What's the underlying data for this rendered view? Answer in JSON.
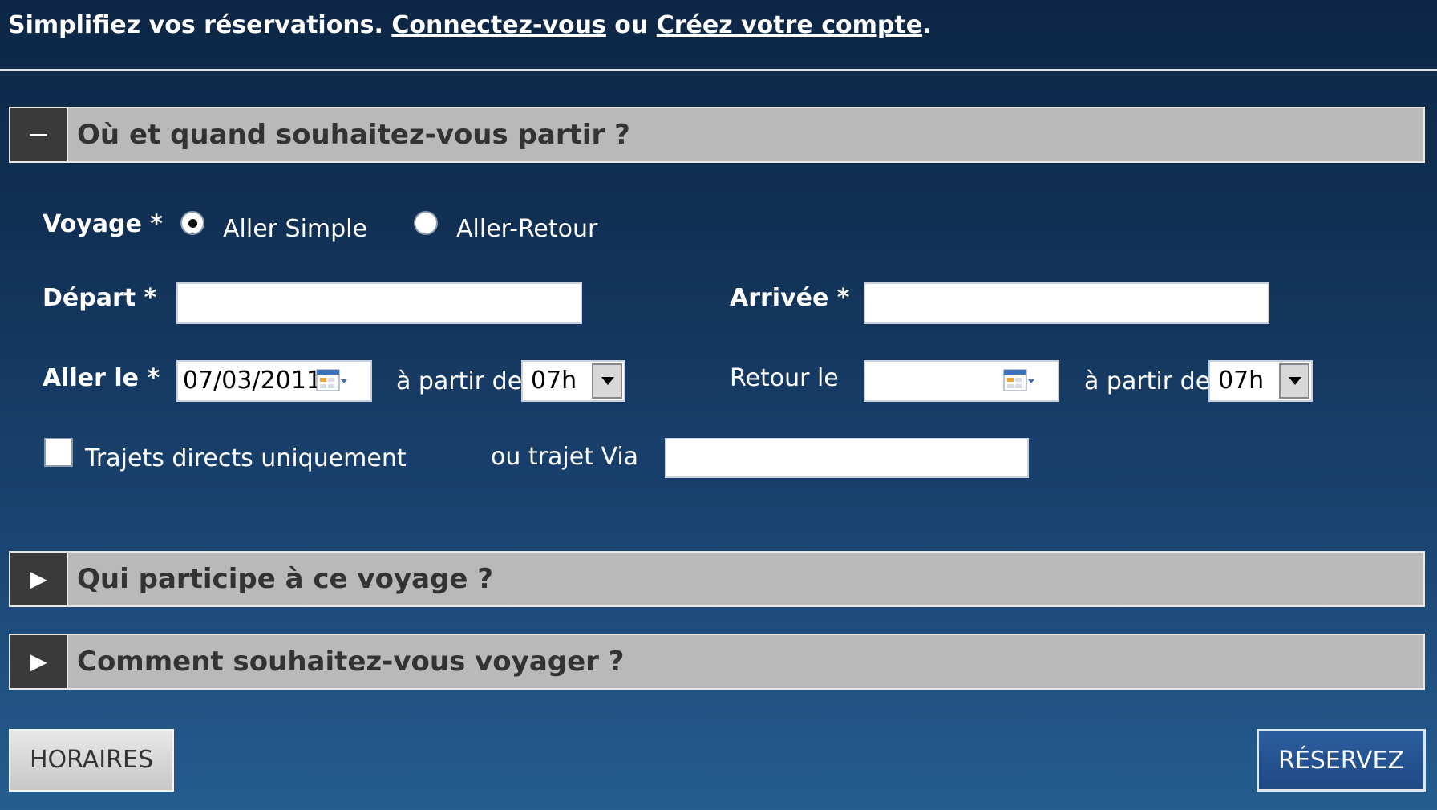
{
  "topbar": {
    "lead": "Simplifiez vos réservations.",
    "login_link": "Connectez-vous",
    "or_text": "ou",
    "signup_link": "Créez votre compte",
    "period": "."
  },
  "sections": [
    {
      "title": "Où et quand souhaitez-vous partir ?",
      "toggle": "−",
      "expanded": true
    },
    {
      "title": "Qui participe à ce voyage ?",
      "toggle": "▶",
      "expanded": false
    },
    {
      "title": "Comment souhaitez-vous voyager ?",
      "toggle": "▶",
      "expanded": false
    }
  ],
  "form": {
    "voyage_label": "Voyage *",
    "trip_options": [
      "Aller Simple",
      "Aller-Retour"
    ],
    "selected_trip": "Aller Simple",
    "depart_label": "Départ *",
    "depart_value": "",
    "arrivee_label": "Arrivée *",
    "arrivee_value": "",
    "aller_label": "Aller le *",
    "aller_date": "07/03/2011",
    "from_label": "à partir de",
    "aller_time": "07h",
    "retour_label": "Retour le",
    "retour_date": "",
    "retour_time": "07h",
    "direct_label": "Trajets directs uniquement",
    "direct_checked": false,
    "via_label": "ou trajet Via",
    "via_value": ""
  },
  "buttons": {
    "horaires": "HORAIRES",
    "reservez": "RÉSERVEZ"
  },
  "colors": {
    "background_top": "#0d2645",
    "background_bottom": "#255d8e",
    "section_bar": "#b9b9b9",
    "toggle_box": "#3a3a3a",
    "primary_button": "#1f4a84"
  }
}
